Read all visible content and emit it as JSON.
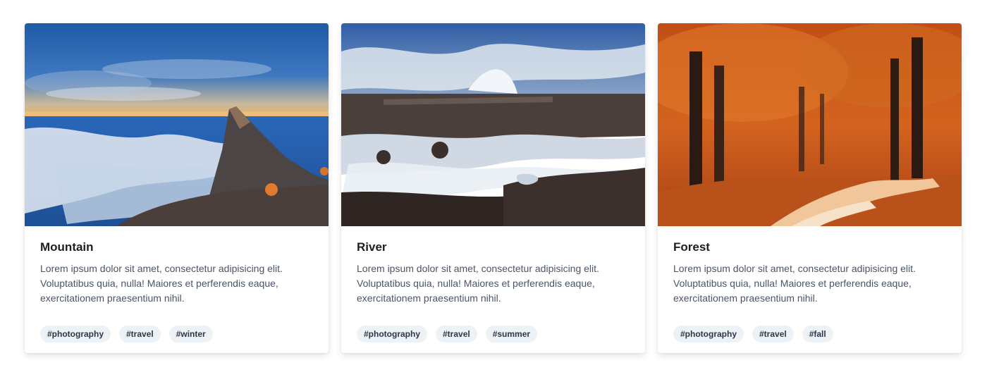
{
  "cards": [
    {
      "title": "Mountain",
      "image_subject": "mountain peak above sea of clouds",
      "text": "Lorem ipsum dolor sit amet, consectetur adipisicing elit. Voluptatibus quia, nulla! Maiores et perferendis eaque, exercitationem praesentium nihil.",
      "tags": [
        "#photography",
        "#travel",
        "#winter"
      ]
    },
    {
      "title": "River",
      "image_subject": "long-exposure waterfall river under cloudy sky",
      "text": "Lorem ipsum dolor sit amet, consectetur adipisicing elit. Voluptatibus quia, nulla! Maiores et perferendis eaque, exercitationem praesentium nihil.",
      "tags": [
        "#photography",
        "#travel",
        "#summer"
      ]
    },
    {
      "title": "Forest",
      "image_subject": "autumn forest path with orange leaves",
      "text": "Lorem ipsum dolor sit amet, consectetur adipisicing elit. Voluptatibus quia, nulla! Maiores et perferendis eaque, exercitationem praesentium nihil.",
      "tags": [
        "#photography",
        "#travel",
        "#fall"
      ]
    }
  ],
  "colors": {
    "title": "#1f1f1f",
    "body_text": "#4a5568",
    "tag_bg": "#edf2f7",
    "tag_text": "#2d3748"
  }
}
